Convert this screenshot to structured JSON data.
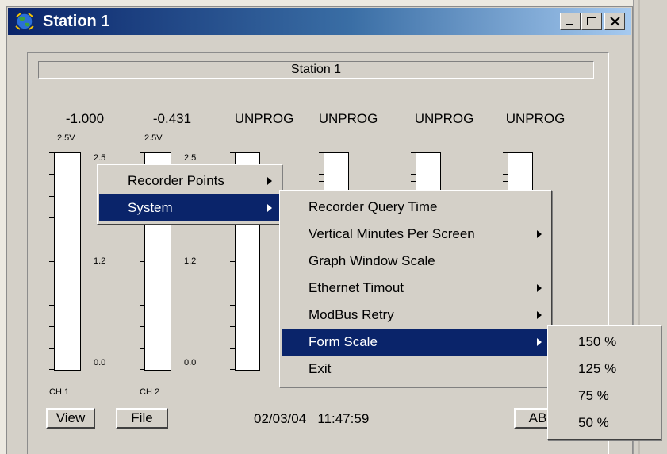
{
  "window": {
    "title": "Station 1",
    "icon": "globe-icon"
  },
  "panel_title": "Station 1",
  "channels": [
    {
      "value": "-1.000",
      "volt": "2.5V",
      "label": "CH 1",
      "scale_top": "2.5",
      "scale_mid": "1.2",
      "scale_bot": "0.0"
    },
    {
      "value": "-0.431",
      "volt": "2.5V",
      "label": "CH 2",
      "scale_top": "2.5",
      "scale_mid": "1.2",
      "scale_bot": "0.0"
    },
    {
      "value": "UNPROG"
    },
    {
      "value": "UNPROG"
    },
    {
      "value": "UNPROG"
    },
    {
      "value": "UNPROG"
    }
  ],
  "toolbar": {
    "view_label": "View",
    "file_label": "File",
    "about_label": "AB"
  },
  "status": {
    "date": "02/03/04",
    "time": "11:47:59"
  },
  "context_menu": {
    "items": [
      {
        "label": "Recorder Points"
      },
      {
        "label": "System"
      }
    ]
  },
  "system_menu": {
    "items": [
      {
        "label": "Recorder Query Time"
      },
      {
        "label": "Vertical Minutes Per Screen"
      },
      {
        "label": "Graph Window Scale"
      },
      {
        "label": "Ethernet Timout"
      },
      {
        "label": "ModBus Retry"
      },
      {
        "label": "Form Scale"
      },
      {
        "label": "Exit"
      }
    ]
  },
  "form_scale_menu": {
    "items": [
      {
        "label": "150 %"
      },
      {
        "label": "125 %"
      },
      {
        "label": "75 %"
      },
      {
        "label": "50 %"
      }
    ]
  }
}
